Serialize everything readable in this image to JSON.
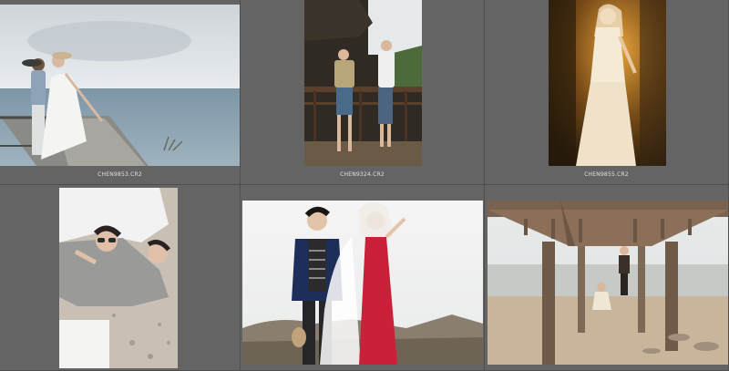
{
  "browser": {
    "thumbnails": [
      {
        "filename": "CHEN9853.CR2",
        "scene": "seaside-pier-couple"
      },
      {
        "filename": "CHEN9324.CR2",
        "scene": "wooden-deck-couple"
      },
      {
        "filename": "CHEN9855.CR2",
        "scene": "bride-golden-light"
      },
      {
        "filename": "",
        "scene": "couple-lying-sunglasses"
      },
      {
        "filename": "",
        "scene": "groom-bride-red-dress"
      },
      {
        "filename": "",
        "scene": "under-pier-beach"
      }
    ]
  },
  "colors": {
    "background": "#646464",
    "cell_border": "#4e4e4e",
    "filename_text": "#e0e0e0"
  }
}
